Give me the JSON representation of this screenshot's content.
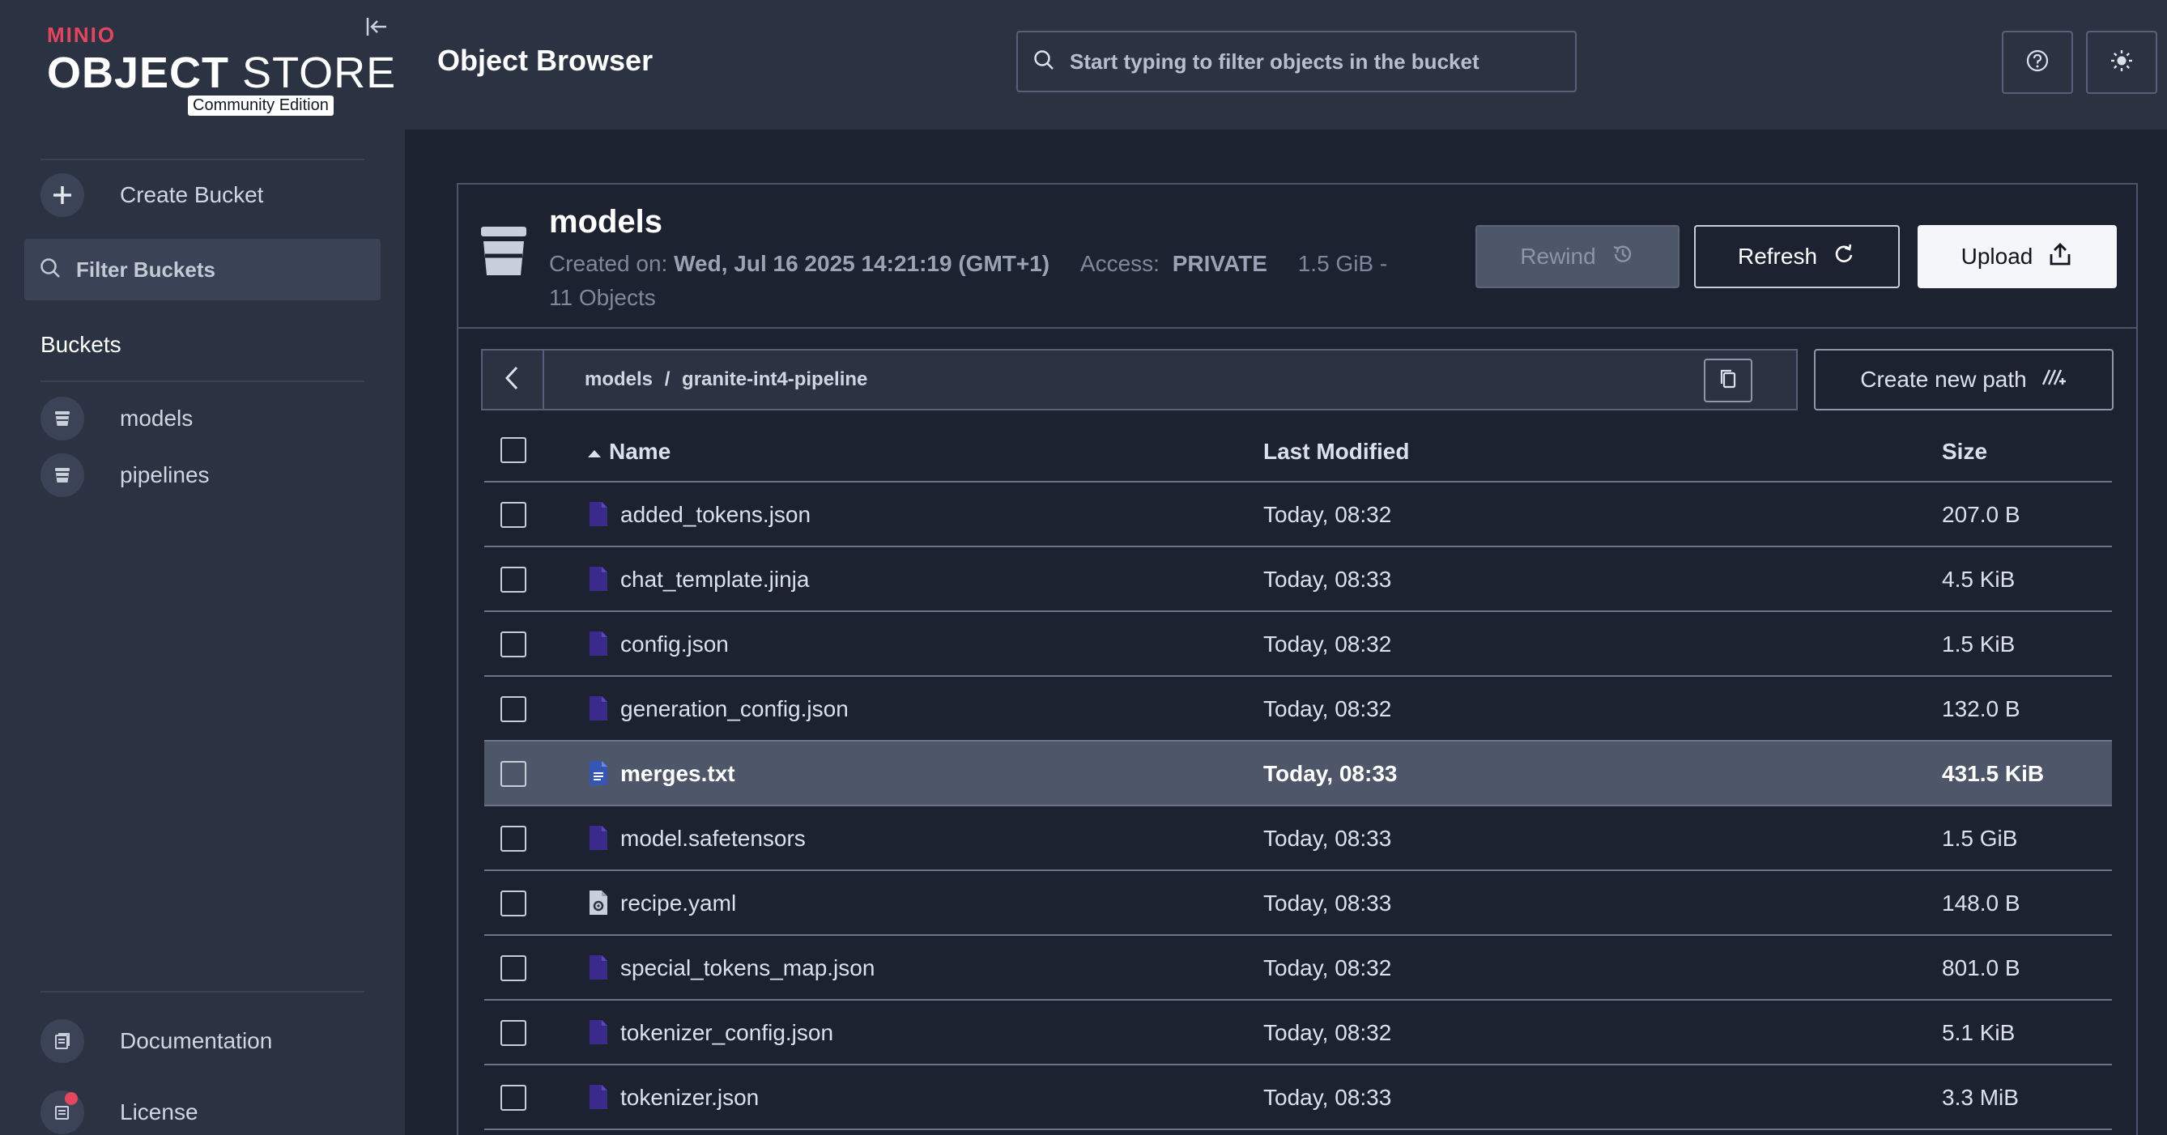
{
  "sidebar": {
    "logo_brand": "MINIO",
    "logo_title_bold": "OBJECT",
    "logo_title_light": " STORE",
    "logo_edition": "Community Edition",
    "create_bucket": "Create Bucket",
    "filter_placeholder": "Filter Buckets",
    "buckets_heading": "Buckets",
    "buckets": [
      "models",
      "pipelines"
    ],
    "documentation": "Documentation",
    "license": "License"
  },
  "header": {
    "title": "Object Browser",
    "search_placeholder": "Start typing to filter objects in the bucket"
  },
  "bucket": {
    "name": "models",
    "created_label": "Created on:",
    "created_value": "Wed, Jul 16 2025 14:21:19 (GMT+1)",
    "access_label": "Access:",
    "access_value": "PRIVATE",
    "size_summary": "1.5 GiB -",
    "objects_count": "11 Objects",
    "rewind_label": "Rewind",
    "refresh_label": "Refresh",
    "upload_label": "Upload"
  },
  "path": {
    "bucket": "models",
    "separator": "/",
    "folder": "granite-int4-pipeline",
    "create_new_path": "Create new path"
  },
  "table": {
    "columns": {
      "name": "Name",
      "modified": "Last Modified",
      "size": "Size"
    },
    "rows": [
      {
        "name": "added_tokens.json",
        "modified": "Today, 08:32",
        "size": "207.0 B",
        "icon": "file-icon"
      },
      {
        "name": "chat_template.jinja",
        "modified": "Today, 08:33",
        "size": "4.5 KiB",
        "icon": "file-icon"
      },
      {
        "name": "config.json",
        "modified": "Today, 08:32",
        "size": "1.5 KiB",
        "icon": "file-icon"
      },
      {
        "name": "generation_config.json",
        "modified": "Today, 08:32",
        "size": "132.0 B",
        "icon": "file-icon"
      },
      {
        "name": "merges.txt",
        "modified": "Today, 08:33",
        "size": "431.5 KiB",
        "icon": "text-file-icon",
        "selected": true
      },
      {
        "name": "model.safetensors",
        "modified": "Today, 08:33",
        "size": "1.5 GiB",
        "icon": "file-icon"
      },
      {
        "name": "recipe.yaml",
        "modified": "Today, 08:33",
        "size": "148.0 B",
        "icon": "config-file-icon"
      },
      {
        "name": "special_tokens_map.json",
        "modified": "Today, 08:32",
        "size": "801.0 B",
        "icon": "file-icon"
      },
      {
        "name": "tokenizer_config.json",
        "modified": "Today, 08:32",
        "size": "5.1 KiB",
        "icon": "file-icon"
      },
      {
        "name": "tokenizer.json",
        "modified": "Today, 08:33",
        "size": "3.3 MiB",
        "icon": "file-icon"
      }
    ]
  },
  "colors": {
    "sidebar_bg": "#2b3343",
    "main_bg": "#1c2230",
    "brand_red": "#e6455e",
    "file_icon": "#3a2a8c",
    "selected_row": "#4e5769"
  }
}
